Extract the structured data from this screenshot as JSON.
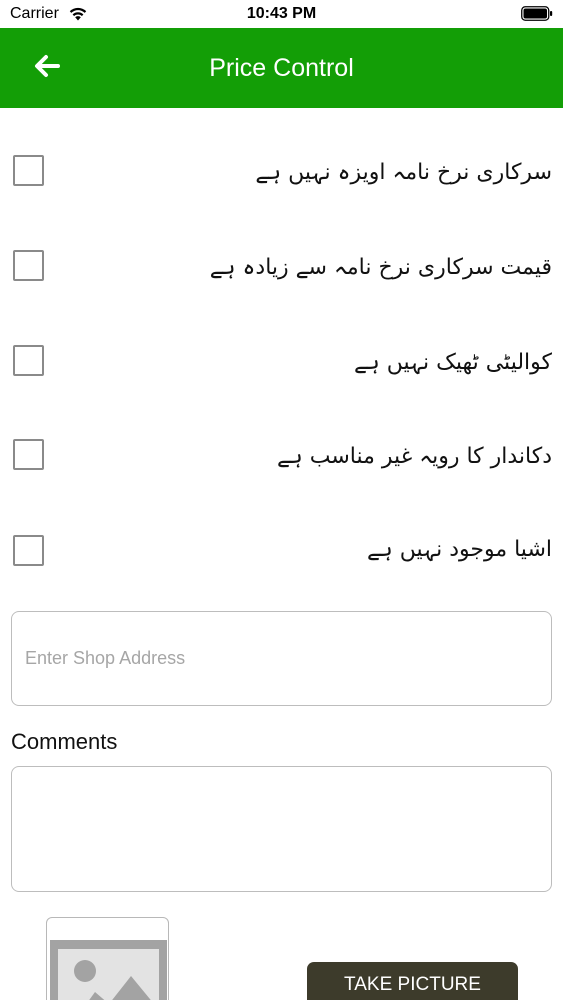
{
  "status_bar": {
    "carrier": "Carrier",
    "time": "10:43 PM",
    "wifi_icon": "wifi-icon",
    "battery_icon": "battery-icon"
  },
  "nav": {
    "title": "Price Control",
    "back_icon": "arrow-left-icon",
    "background_color": "#139e06"
  },
  "options": [
    {
      "label": "سرکاری نرخ نامہ اویزہ نہیں ہے",
      "checked": false
    },
    {
      "label": "قیمت سرکاری نرخ نامہ سے زیادہ ہے",
      "checked": false
    },
    {
      "label": "کوالیٹی ٹھیک نہیں ہے",
      "checked": false
    },
    {
      "label": "دکاندار کا رویہ غیر مناسب ہے",
      "checked": false
    },
    {
      "label": "اشیا موجود نہیں ہے",
      "checked": false
    }
  ],
  "address_input": {
    "placeholder": "Enter Shop Address",
    "value": ""
  },
  "comments": {
    "label": "Comments",
    "value": ""
  },
  "photo": {
    "placeholder_icon": "image-placeholder-icon",
    "button_label": "TAKE PICTURE",
    "button_color": "#3d3b2b"
  }
}
